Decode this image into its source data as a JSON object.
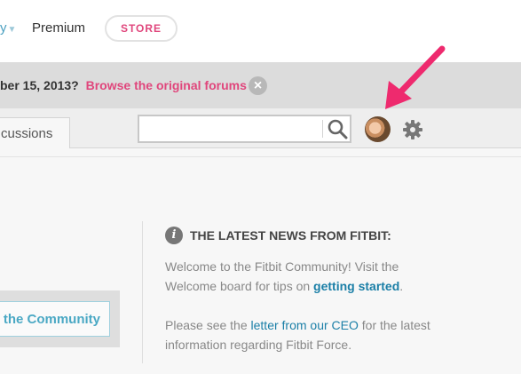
{
  "header": {
    "nav_partial": "y",
    "nav_premium": "Premium",
    "store_button": "STORE"
  },
  "notice": {
    "text": "ber 15, 2013?",
    "link": "Browse the original forums",
    "close_glyph": "×"
  },
  "toolbar": {
    "tab_label": "cussions",
    "search_placeholder": "",
    "search_value": ""
  },
  "sidebar": {
    "community_button": "k the Community"
  },
  "news": {
    "icon_glyph": "i",
    "title": "THE LATEST NEWS FROM FITBIT:",
    "p1_text": "Welcome to the Fitbit Community! Visit the Welcome board for tips on",
    "p1_link": "getting started",
    "p1_end": ".",
    "p2_text": "Please see the",
    "p2_link": "letter from our CEO",
    "p2_end": "for the latest information regarding Fitbit Force."
  },
  "colors": {
    "accent_pink": "#e0467c",
    "link_blue": "#1b7fa7",
    "arrow": "#ee2a6e"
  }
}
